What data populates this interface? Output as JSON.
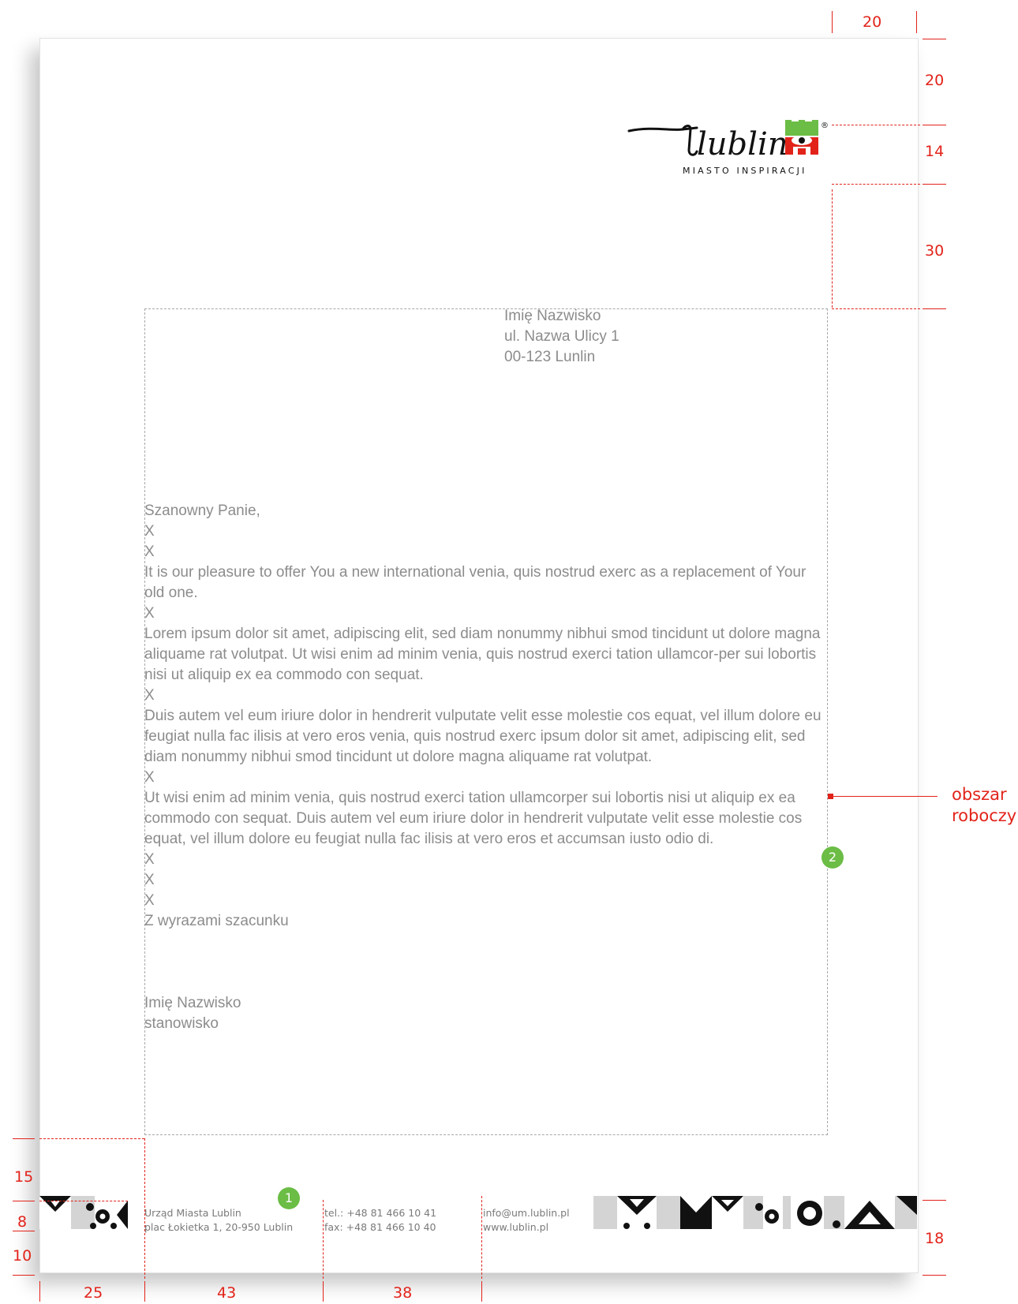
{
  "logo": {
    "wordmark": "lublin",
    "tagline": "MIASTO INSPIRACJI",
    "registered": "®",
    "colors": {
      "green": "#6bbd45",
      "red": "#e2231a",
      "black": "#111111"
    }
  },
  "recipient": {
    "name": "Imię Nazwisko",
    "street": "ul. Nazwa Ulicy 1",
    "city": "00-123 Lunlin"
  },
  "body": {
    "greeting": "Szanowny Panie,",
    "spacer": "X",
    "paragraph1": "It is our pleasure to offer You a new international venia, quis nostrud exerc as a replacement of Your old one.",
    "paragraph2": "Lorem ipsum dolor sit amet, adipiscing elit, sed diam nonummy nibhui smod tincidunt ut dolore magna aliquame rat volutpat. Ut wisi enim ad minim venia, quis nostrud exerci tation ullamcor-per sui lobortis nisi ut aliquip ex ea commodo con sequat.",
    "paragraph3": "Duis autem vel eum iriure dolor in hendrerit vulputate velit esse molestie cos equat, vel illum dolore eu feugiat nulla fac ilisis at vero eros venia, quis nostrud exerc ipsum dolor sit amet, adipiscing elit, sed diam nonummy nibhui smod tincidunt ut dolore magna aliquame rat volutpat.",
    "paragraph4": "Ut wisi enim ad minim venia, quis nostrud exerci tation ullamcorper sui lobortis nisi ut aliquip ex ea commodo con sequat. Duis autem vel eum iriure dolor in hendrerit vulputate velit esse molestie cos equat, vel illum dolore eu feugiat nulla fac ilisis at vero eros et accumsan iusto odio di.",
    "closing": "Z wyrazami szacunku",
    "signature_name": "Imię Nazwisko",
    "signature_title": "stanowisko"
  },
  "footer": {
    "office_name": "Urząd Miasta Lublin",
    "office_address": "plac Łokietka 1, 20-950 Lublin",
    "tel": "tel.: +48 81 466 10 41",
    "fax": "fax: +48 81 466 10 40",
    "email": "info@um.lublin.pl",
    "web": "www.lublin.pl"
  },
  "annotations": {
    "work_area_label_line1": "obszar",
    "work_area_label_line2": "roboczy",
    "marker_1": "1",
    "marker_2": "2",
    "dim_top_right_margin": "20",
    "dim_top_margin": "20",
    "dim_logo_height": "14",
    "dim_logo_gap": "30",
    "dim_footer_gap": "15",
    "dim_pattern_height": "8",
    "dim_bottom_margin": "10",
    "dim_footer_right": "18",
    "dim_col_1": "25",
    "dim_col_2": "43",
    "dim_col_3": "38"
  }
}
